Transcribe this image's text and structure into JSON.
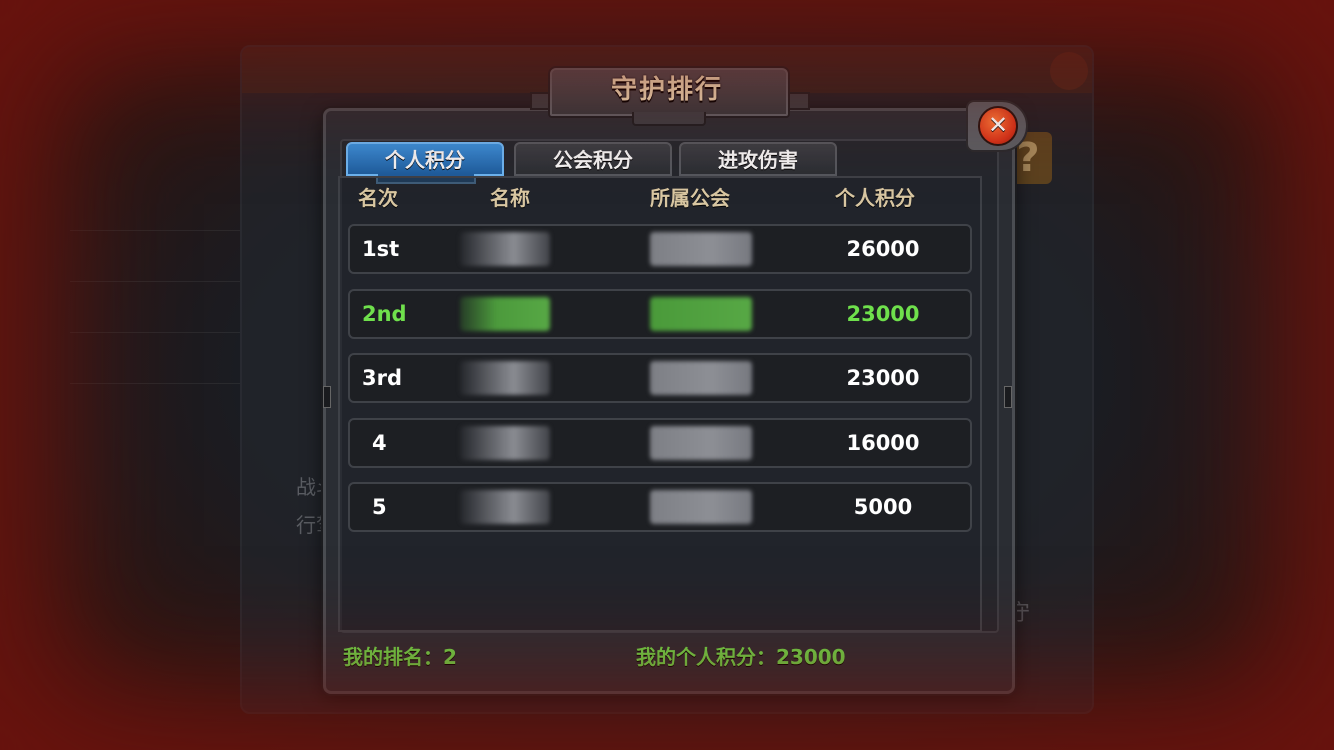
{
  "dialog": {
    "title": "守护排行",
    "close_icon_glyph": "✕"
  },
  "tabs": [
    {
      "label": "个人积分",
      "active": true
    },
    {
      "label": "公会积分",
      "active": false
    },
    {
      "label": "进攻伤害",
      "active": false
    }
  ],
  "columns": {
    "rank": "名次",
    "name": "名称",
    "guild": "所属公会",
    "score": "个人积分"
  },
  "rows": [
    {
      "rank": "1st",
      "score": "26000",
      "highlight": false
    },
    {
      "rank": "2nd",
      "score": "23000",
      "highlight": true
    },
    {
      "rank": "3rd",
      "score": "23000",
      "highlight": false
    },
    {
      "rank": "4",
      "score": "16000",
      "highlight": false
    },
    {
      "rank": "5",
      "score": "5000",
      "highlight": false
    }
  ],
  "footer": {
    "my_rank": "我的排名：2",
    "my_score": "我的个人积分：23000"
  },
  "background": {
    "help_glyph": "?",
    "left_text": "战斗\n行驾",
    "right_text": "守"
  },
  "colors": {
    "highlight": "#6fe04c",
    "active_tab": "#2f7cc6",
    "close_button": "#d8341a",
    "title_text": "#f1dfb8"
  }
}
